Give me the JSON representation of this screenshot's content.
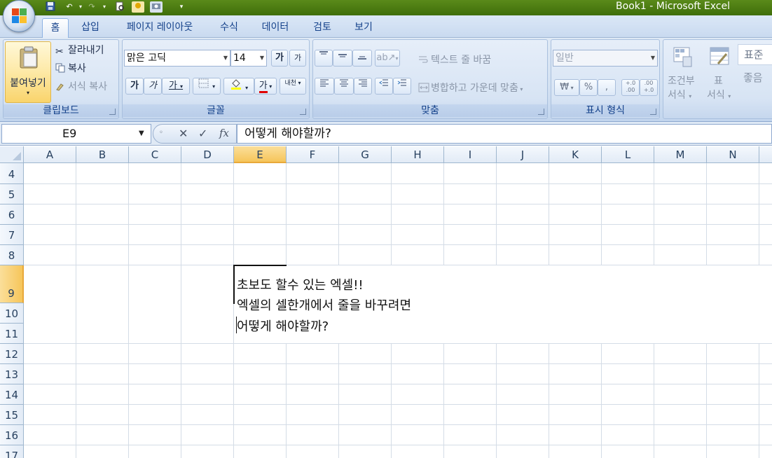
{
  "window": {
    "title": "Book1  -  Microsoft Excel"
  },
  "tabs": [
    "홈",
    "삽입",
    "페이지 레이아웃",
    "수식",
    "데이터",
    "검토",
    "보기"
  ],
  "ribbon": {
    "clipboard": {
      "label": "클립보드",
      "paste": "붙여넣기",
      "cut": "잘라내기",
      "copy": "복사",
      "format_painter": "서식 복사"
    },
    "font": {
      "label": "글꼴",
      "font_name": "맑은 고딕",
      "font_size": "14",
      "grow": "가",
      "shrink": "가",
      "bold": "가",
      "italic": "가",
      "underline": "가",
      "font_color": "가",
      "phonetic": "내천"
    },
    "alignment": {
      "label": "맞춤",
      "wrap_text": "텍스트 줄 바꿈",
      "merge_center": "병합하고 가운데 맞춤"
    },
    "number": {
      "label": "표시 형식",
      "format": "일반",
      "currency": "₩",
      "percent": "%",
      "comma": ",",
      "inc_decimal": "+.0 .00",
      "dec_decimal": ".00 +.0"
    },
    "styles": {
      "conditional_format": "조건부\n서식",
      "conditional_format_l1": "조건부",
      "conditional_format_l2": "서식",
      "table_format_l1": "표",
      "table_format_l2": "서식",
      "style_normal": "표준",
      "style_good": "좋음"
    }
  },
  "formula_bar": {
    "name_box": "E9",
    "formula": "어떻게 해야할까?",
    "fx": "fx"
  },
  "sheet": {
    "columns": [
      "A",
      "B",
      "C",
      "D",
      "E",
      "F",
      "G",
      "H",
      "I",
      "J",
      "K",
      "L",
      "M",
      "N"
    ],
    "selected_column": "E",
    "rows": [
      "4",
      "5",
      "6",
      "7",
      "8",
      "9",
      "10",
      "11",
      "12",
      "13",
      "14",
      "15",
      "16",
      "17"
    ],
    "selected_row": "9",
    "active_cell": "E9",
    "cell_lines": [
      "초보도 할수 있는 엑셀!!",
      "엑셀의 셀한개에서 줄을 바꾸려면",
      "어떻게 해야할까?"
    ]
  }
}
